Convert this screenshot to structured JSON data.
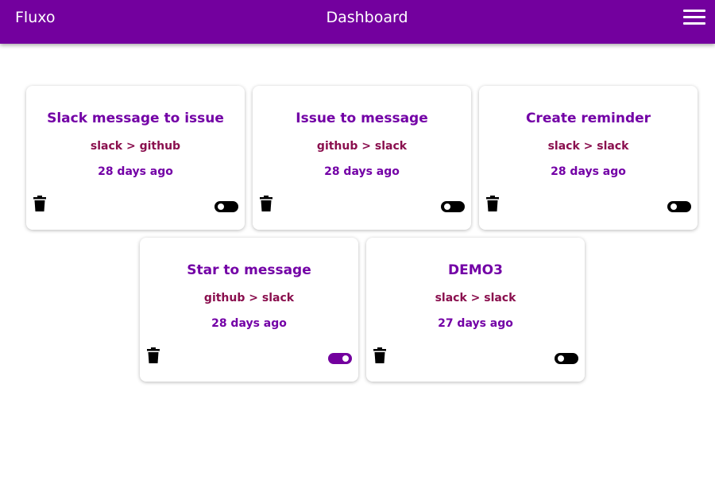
{
  "header": {
    "brand": "Fluxo",
    "title": "Dashboard",
    "menu_icon": "hamburger-menu-icon",
    "color": "#73009e"
  },
  "cards": [
    {
      "title": "Slack message to issue",
      "route": "slack > github",
      "time": "28 days ago",
      "enabled": false
    },
    {
      "title": "Issue to message",
      "route": "github > slack",
      "time": "28 days ago",
      "enabled": false
    },
    {
      "title": "Create reminder",
      "route": "slack > slack",
      "time": "28 days ago",
      "enabled": false
    },
    {
      "title": "Star to message",
      "route": "github > slack",
      "time": "28 days ago",
      "enabled": true
    },
    {
      "title": "DEMO3",
      "route": "slack > slack",
      "time": "27 days ago",
      "enabled": false
    }
  ],
  "icons": {
    "delete": "trash-icon"
  }
}
